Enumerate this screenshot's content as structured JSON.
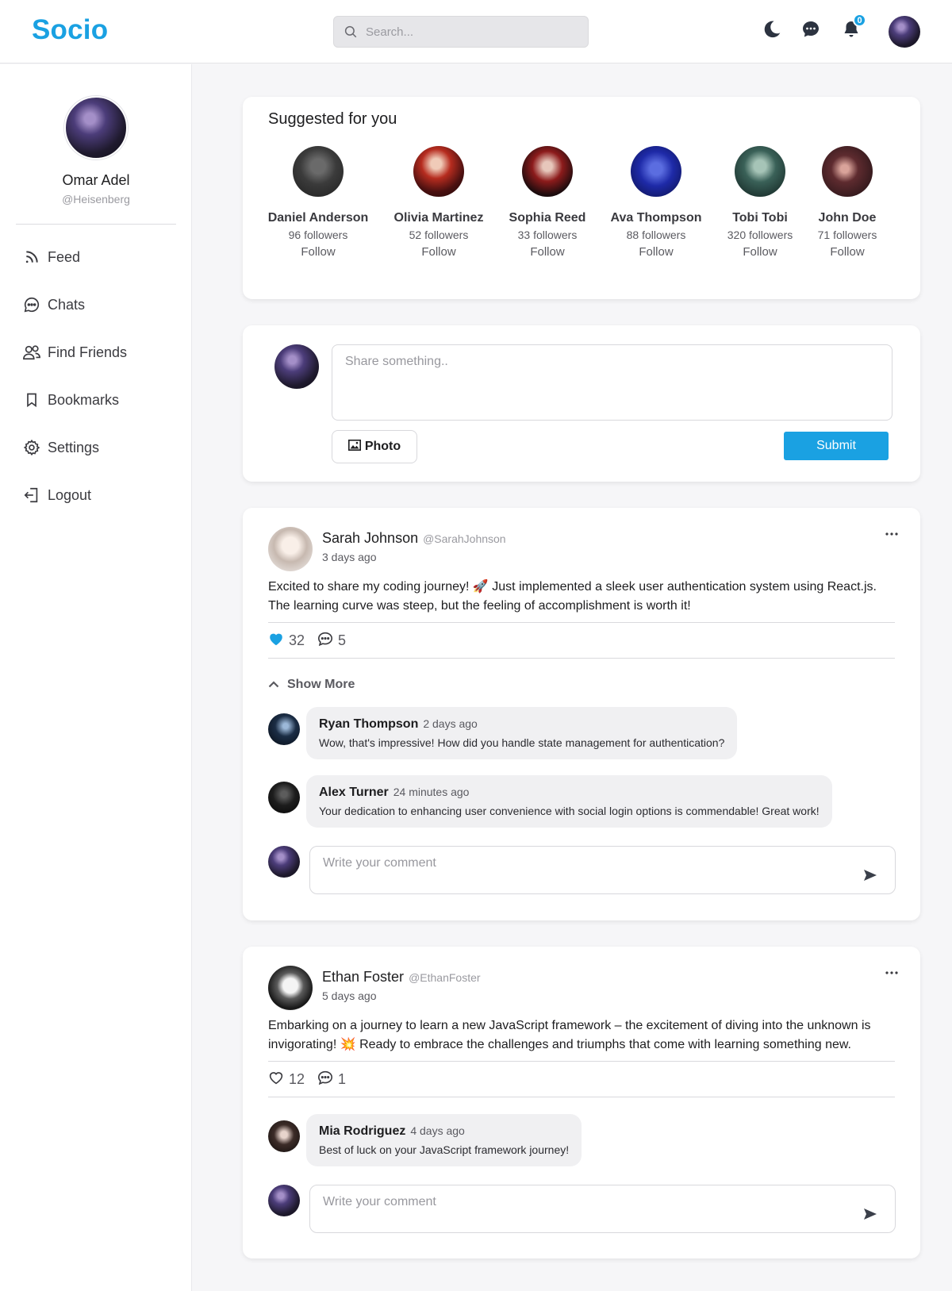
{
  "header": {
    "logo": "Socio",
    "search_placeholder": "Search...",
    "notification_count": "0"
  },
  "colors": {
    "accent": "#1aa1e2"
  },
  "sidebar": {
    "name": "Omar Adel",
    "handle": "@Heisenberg",
    "items": [
      {
        "label": "Feed",
        "icon": "rss-icon"
      },
      {
        "label": "Chats",
        "icon": "chat-bubble-icon"
      },
      {
        "label": "Find Friends",
        "icon": "users-icon"
      },
      {
        "label": "Bookmarks",
        "icon": "bookmark-icon"
      },
      {
        "label": "Settings",
        "icon": "gear-icon"
      },
      {
        "label": "Logout",
        "icon": "logout-icon"
      }
    ]
  },
  "suggestions": {
    "title": "Suggested for you",
    "users": [
      {
        "name": "Daniel Anderson",
        "followers": "96 followers",
        "action": "Follow"
      },
      {
        "name": "Olivia Martinez",
        "followers": "52 followers",
        "action": "Follow"
      },
      {
        "name": "Sophia Reed",
        "followers": "33 followers",
        "action": "Follow"
      },
      {
        "name": "Ava Thompson",
        "followers": "88 followers",
        "action": "Follow"
      },
      {
        "name": "Tobi Tobi",
        "followers": "320 followers",
        "action": "Follow"
      },
      {
        "name": "John Doe",
        "followers": "71 followers",
        "action": "Follow"
      }
    ]
  },
  "composer": {
    "placeholder": "Share something..",
    "photo_label": "Photo",
    "submit_label": "Submit"
  },
  "posts": [
    {
      "author": "Sarah Johnson",
      "handle": "@SarahJohnson",
      "time": "3 days ago",
      "text_line1": "Excited to share my coding journey! 🚀 Just implemented a sleek user authentication system using React.js.",
      "text_line2": "The learning curve was steep, but the feeling of accomplishment is worth it!",
      "likes": "32",
      "liked": true,
      "comments_count": "5",
      "show_more": "Show More",
      "comments": [
        {
          "name": "Ryan Thompson",
          "time": "2 days ago",
          "text": "Wow, that's impressive! How did you handle state management for authentication?"
        },
        {
          "name": "Alex Turner",
          "time": "24 minutes ago",
          "text": "Your dedication to enhancing user convenience with social login options is commendable! Great work!"
        }
      ],
      "comment_placeholder": "Write your comment"
    },
    {
      "author": "Ethan Foster",
      "handle": "@EthanFoster",
      "time": "5 days ago",
      "text_line1": "Embarking on a journey to learn a new JavaScript framework – the excitement of diving into the unknown is",
      "text_line2": "invigorating! 💥 Ready to embrace the challenges and triumphs that come with learning something new.",
      "likes": "12",
      "liked": false,
      "comments_count": "1",
      "comments": [
        {
          "name": "Mia Rodriguez",
          "time": "4 days ago",
          "text": "Best of luck on your JavaScript framework journey!"
        }
      ],
      "comment_placeholder": "Write your comment"
    }
  ]
}
